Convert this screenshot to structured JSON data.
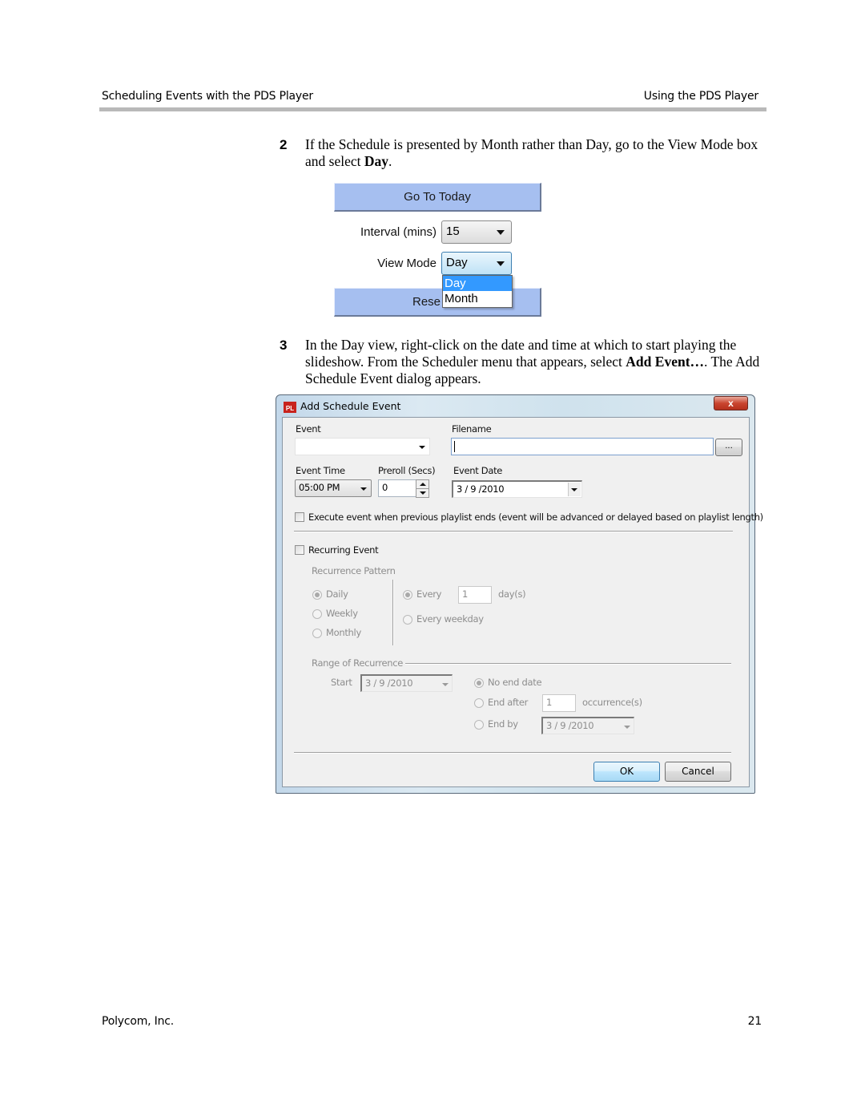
{
  "page_header": {
    "left": "Scheduling Events with the PDS Player",
    "right": "Using the PDS Player"
  },
  "steps": [
    {
      "number": "2",
      "text_parts": [
        {
          "t": "If the Schedule is presented by Month rather than Day, go to the View Mode box and select ",
          "b": false
        },
        {
          "t": "Day",
          "b": true
        },
        {
          "t": ".",
          "b": false
        }
      ]
    },
    {
      "number": "3",
      "text_parts": [
        {
          "t": "In the Day view, right-click on the date and time at which to start playing the slideshow. From the Scheduler menu that appears, select ",
          "b": false
        },
        {
          "t": "Add Event…",
          "b": true
        },
        {
          "t": ". The Add Schedule Event dialog appears.",
          "b": false
        }
      ]
    }
  ],
  "figure1": {
    "go_to_today_label": "Go To Today",
    "interval_label": "Interval (mins)",
    "interval_value": "15",
    "view_mode_label": "View Mode",
    "view_mode_value": "Day",
    "view_mode_options": [
      "Day",
      "Month"
    ],
    "view_mode_highlighted": "Day",
    "reset_label_visible": "Rese"
  },
  "dialog": {
    "title": "Add Schedule Event",
    "app_icon_text": "PL",
    "close_glyph": "x",
    "event_label": "Event",
    "event_value": "",
    "filename_label": "Filename",
    "filename_value": "",
    "browse_label": "...",
    "event_time_label": "Event Time",
    "event_time_value": "05:00 PM",
    "preroll_label": "Preroll (Secs)",
    "preroll_value": "0",
    "event_date_label": "Event Date",
    "event_date_value": "3 / 9 /2010",
    "execute_checkbox_label": "Execute event when previous playlist ends (event will be advanced or delayed based on playlist length)",
    "execute_checked": false,
    "recurring_checkbox_label": "Recurring Event",
    "recurring_checked": false,
    "recurrence_pattern": {
      "heading": "Recurrence Pattern",
      "frequency_options": [
        "Daily",
        "Weekly",
        "Monthly"
      ],
      "frequency_selected": "Daily",
      "every_label": "Every",
      "every_value": "1",
      "every_unit": "day(s)",
      "every_weekday_label": "Every weekday",
      "daily_mode_selected": "Every"
    },
    "range_of_recurrence": {
      "heading": "Range of Recurrence",
      "start_label": "Start",
      "start_value": "3 / 9 /2010",
      "no_end_label": "No end date",
      "end_after_label": "End after",
      "end_after_value": "1",
      "occurrences_label": "occurrence(s)",
      "end_by_label": "End by",
      "end_by_value": "3 / 9 /2010",
      "selected": "No end date"
    },
    "ok_label": "OK",
    "cancel_label": "Cancel"
  },
  "page_footer": {
    "left": "Polycom, Inc.",
    "page_number": "21"
  }
}
